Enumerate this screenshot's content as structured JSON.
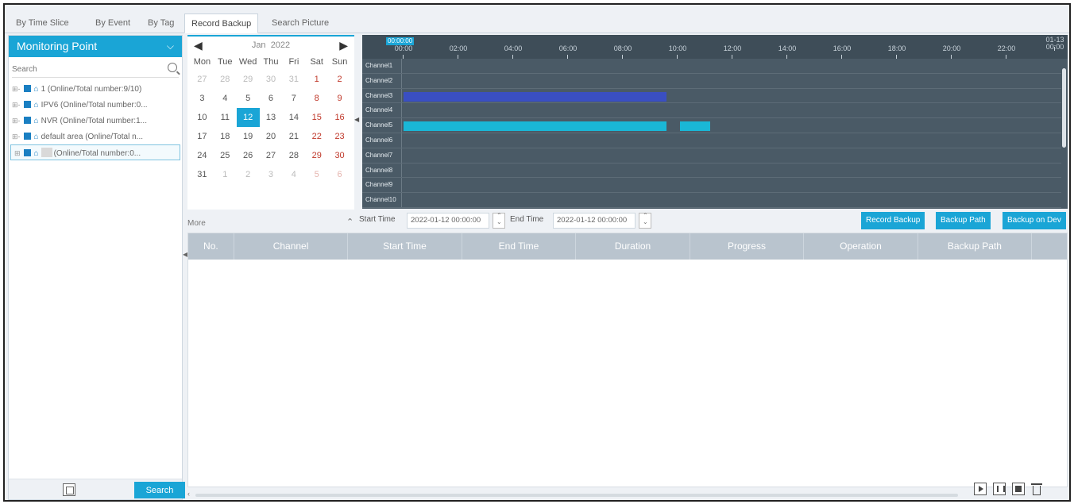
{
  "tabs": [
    "By Time Slice",
    "By Event",
    "By Tag",
    "Record Backup",
    "Search Picture"
  ],
  "active_tab": "Record Backup",
  "left_panel": {
    "title": "Monitoring Point",
    "search_placeholder": "Search",
    "tree": [
      {
        "label": "1 (Online/Total number:9/10)"
      },
      {
        "label": "IPV6 (Online/Total number:0..."
      },
      {
        "label": "NVR (Online/Total number:1..."
      },
      {
        "label": "default area (Online/Total n..."
      },
      {
        "label": "(Online/Total number:0..."
      }
    ],
    "search_button": "Search"
  },
  "calendar": {
    "month": "Jan",
    "year": "2022",
    "dows": [
      "Mon",
      "Tue",
      "Wed",
      "Thu",
      "Fri",
      "Sat",
      "Sun"
    ],
    "days": [
      "27",
      "28",
      "29",
      "30",
      "31",
      "1",
      "2",
      "3",
      "4",
      "5",
      "6",
      "7",
      "8",
      "9",
      "10",
      "11",
      "12",
      "13",
      "14",
      "15",
      "16",
      "17",
      "18",
      "19",
      "20",
      "21",
      "22",
      "23",
      "24",
      "25",
      "26",
      "27",
      "28",
      "29",
      "30",
      "31",
      "1",
      "2",
      "3",
      "4",
      "5",
      "6"
    ],
    "selected_day": "12"
  },
  "timeline": {
    "cursor_time": "00:00:00",
    "ticks": [
      "00:00",
      "02:00",
      "04:00",
      "06:00",
      "08:00",
      "10:00",
      "12:00",
      "14:00",
      "16:00",
      "18:00",
      "20:00",
      "22:00"
    ],
    "end_tick_date": "01-13",
    "end_tick_time": "00:00",
    "channels": [
      "Channel1",
      "Channel2",
      "Channel3",
      "Channel4",
      "Channel5",
      "Channel6",
      "Channel7",
      "Channel8",
      "Channel9",
      "Channel10"
    ],
    "recordings": [
      {
        "channel": "Channel3",
        "color": "blue",
        "start_h": 0.0,
        "end_h": 9.6
      },
      {
        "channel": "Channel5",
        "color": "cyan",
        "start_h": 0.0,
        "end_h": 9.6
      },
      {
        "channel": "Channel5",
        "color": "cyan",
        "start_h": 10.1,
        "end_h": 11.2
      }
    ]
  },
  "toolbar": {
    "more": "More",
    "start_label": "Start Time",
    "start_value": "2022-01-12 00:00:00",
    "end_label": "End Time",
    "end_value": "2022-01-12 00:00:00",
    "record_backup": "Record Backup",
    "backup_path": "Backup Path",
    "backup_on_dev": "Backup on Dev"
  },
  "table": {
    "columns": [
      "No.",
      "Channel",
      "Start Time",
      "End Time",
      "Duration",
      "Progress",
      "Operation",
      "Backup Path"
    ],
    "rows": []
  },
  "colors": {
    "accent": "#1aa5d6",
    "timeline_bg": "#4a5a66",
    "rec_blue": "#3a4fc2",
    "rec_cyan": "#1ab7d6"
  }
}
